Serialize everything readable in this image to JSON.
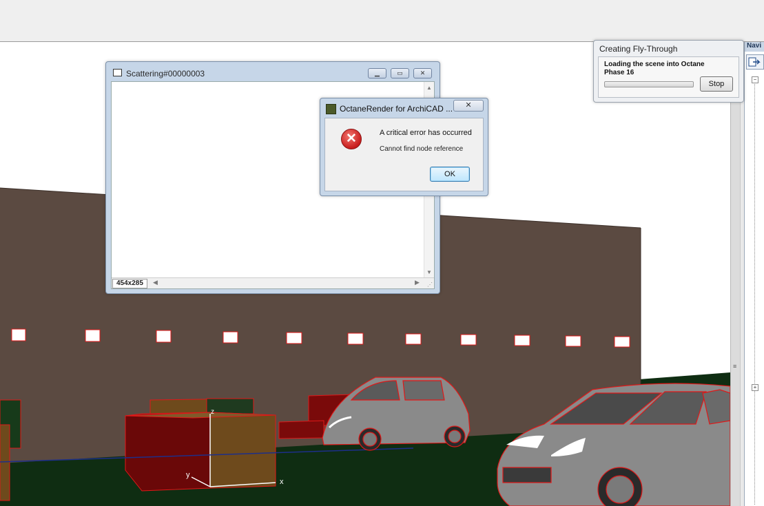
{
  "scattering_window": {
    "title": "Scattering#00000003",
    "size_label": "454x285",
    "icon": "image-window-icon",
    "buttons": {
      "minimize": "minimize-icon",
      "restore": "restore-icon",
      "close": "close-icon"
    }
  },
  "error_dialog": {
    "title": "OctaneRender for ArchiCAD ...",
    "close_glyph": "✕",
    "error_glyph": "✕",
    "message": "A critical error has occurred",
    "detail": "Cannot find node reference",
    "ok_label": "OK"
  },
  "fly_through": {
    "title": "Creating Fly-Through",
    "message_line1": "Loading the scene into Octane",
    "message_line2": "Phase 16",
    "progress_fraction": 0,
    "stop_label": "Stop"
  },
  "navigator": {
    "title": "Navi"
  },
  "viewport": {
    "axis_x_label": "x",
    "axis_y_label": "y",
    "axis_z_label": "z"
  },
  "colors": {
    "wall": "#5b4a41",
    "ground": "#0f2d12",
    "wire": "#e01818",
    "car_body": "#8a8a8a",
    "box_red": "#7a0a0a",
    "box_olive": "#6e4a1c"
  }
}
